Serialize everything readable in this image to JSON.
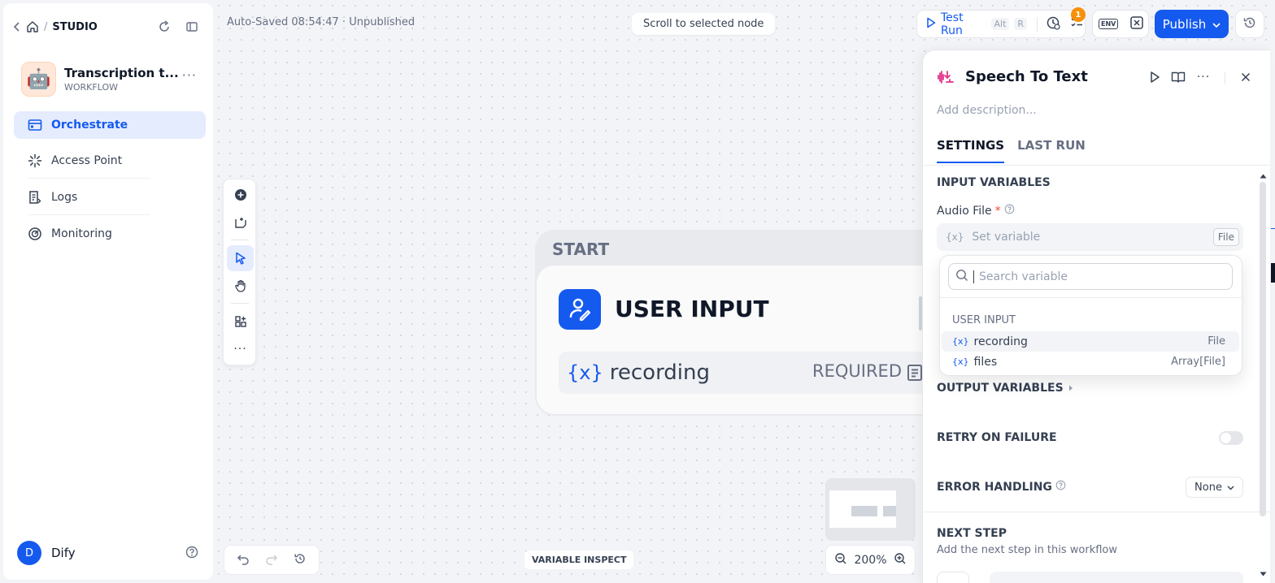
{
  "sidebar": {
    "breadcrumb": "STUDIO",
    "app": {
      "name": "Transcription t...",
      "type": "WORKFLOW",
      "avatar": "🤖"
    },
    "nav": [
      {
        "label": "Orchestrate",
        "icon": "orchestrate-icon",
        "active": true
      },
      {
        "label": "Access Point",
        "icon": "access-point-icon",
        "active": false
      },
      {
        "label": "Logs",
        "icon": "logs-icon",
        "active": false
      },
      {
        "label": "Monitoring",
        "icon": "monitoring-icon",
        "active": false
      }
    ],
    "user": {
      "initial": "D",
      "name": "Dify"
    }
  },
  "header": {
    "autosave": "Auto-Saved 08:54:47 · Unpublished",
    "scroll_button": "Scroll to selected node",
    "test_run": {
      "label": "Test Run",
      "shortcut_1": "Alt",
      "shortcut_2": "R"
    },
    "checklist_badge": "1",
    "env_label": "ENV",
    "publish_label": "Publish"
  },
  "canvas": {
    "start_node": {
      "label": "START",
      "title": "USER INPUT",
      "variable": {
        "symbol": "{x}",
        "name": "recording",
        "status": "REQUIRED"
      }
    },
    "variable_inspect": "VARIABLE INSPECT",
    "zoom": "200%"
  },
  "panel": {
    "title": "Speech To Text",
    "description_placeholder": "Add description...",
    "tabs": [
      {
        "label": "SETTINGS",
        "active": true
      },
      {
        "label": "LAST RUN",
        "active": false
      }
    ],
    "input_variables_heading": "INPUT VARIABLES",
    "audio_field": {
      "label": "Audio File",
      "required_mark": "*",
      "placeholder": "Set variable",
      "type_tag": "File",
      "symbol": "{x}"
    },
    "output_variables_heading": "OUTPUT VARIABLES",
    "retry_heading": "RETRY ON FAILURE",
    "retry_enabled": false,
    "error_handling": {
      "label": "ERROR HANDLING",
      "value": "None"
    },
    "next_step": {
      "heading": "NEXT STEP",
      "subtitle": "Add the next step in this workflow"
    }
  },
  "variable_dropdown": {
    "search_placeholder": "Search variable",
    "group_label": "USER INPUT",
    "items": [
      {
        "symbol": "{x}",
        "name": "recording",
        "type": "File"
      },
      {
        "symbol": "{x}",
        "name": "files",
        "type": "Array[File]"
      }
    ]
  },
  "colors": {
    "accent": "#155aef",
    "badge": "#f79009",
    "required": "#f04438"
  }
}
